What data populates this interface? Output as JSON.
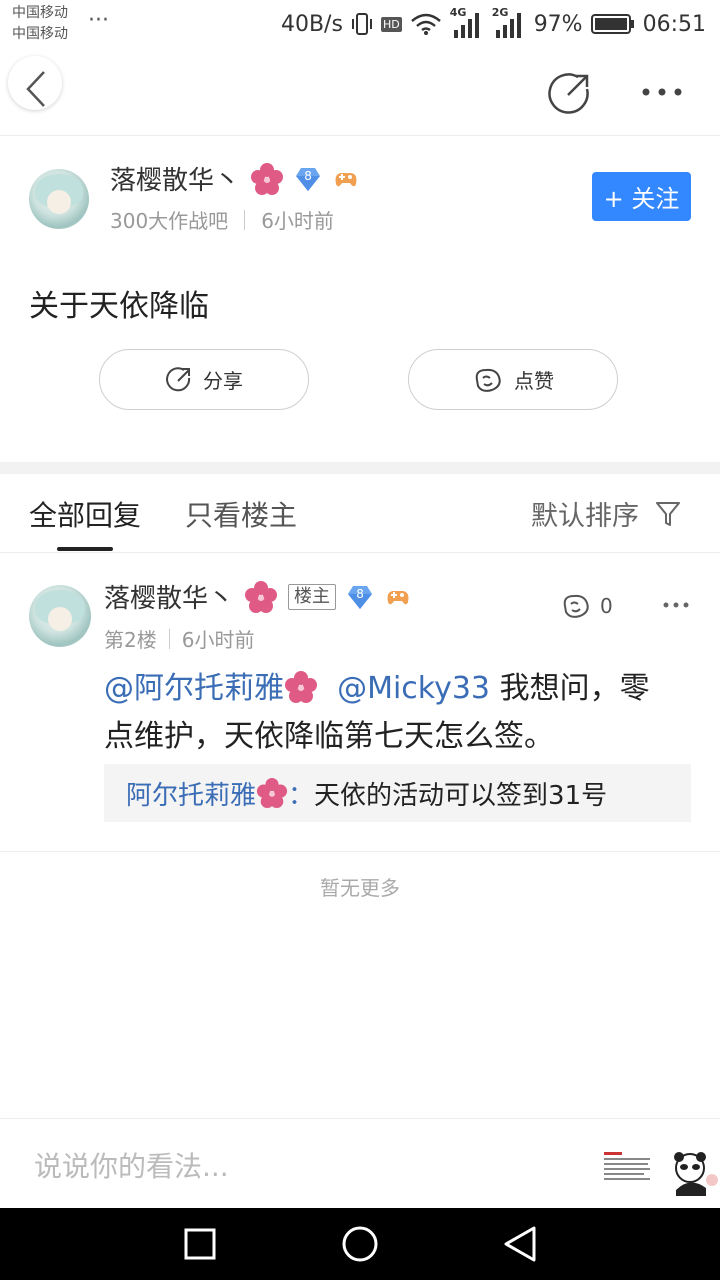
{
  "status_bar": {
    "carrier1": "中国移动",
    "carrier2": "中国移动",
    "more": "···",
    "speed": "40B/s",
    "hd": "HD",
    "net1": "4G",
    "net2": "2G",
    "battery": "97%",
    "time": "06:51"
  },
  "post": {
    "author": "落樱散华丶",
    "level": "8",
    "forum": "300大作战吧",
    "time": "6小时前",
    "follow_label": "+ 关注",
    "title": "关于天依降临",
    "share_label": "分享",
    "like_label": "点赞"
  },
  "tabs": {
    "all_replies": "全部回复",
    "only_op": "只看楼主",
    "sort": "默认排序"
  },
  "reply": {
    "author": "落樱散华丶",
    "op_tag": "楼主",
    "level": "8",
    "floor": "第2楼",
    "time": "6小时前",
    "like_count": "0",
    "mention1": "@阿尔托莉雅",
    "mention2": "@Micky33",
    "text_part1": " 我想问，零",
    "text_part2": "点维护，天依降临第七天怎么签。",
    "quote_author": "阿尔托莉雅",
    "quote_sep": "：",
    "quote_text": "天依的活动可以签到31号"
  },
  "footer": {
    "no_more": "暂无更多",
    "input_placeholder": "说说你的看法..."
  },
  "colors": {
    "accent": "#3388ff",
    "link": "#3a6db5",
    "flower": "#e05a86"
  }
}
